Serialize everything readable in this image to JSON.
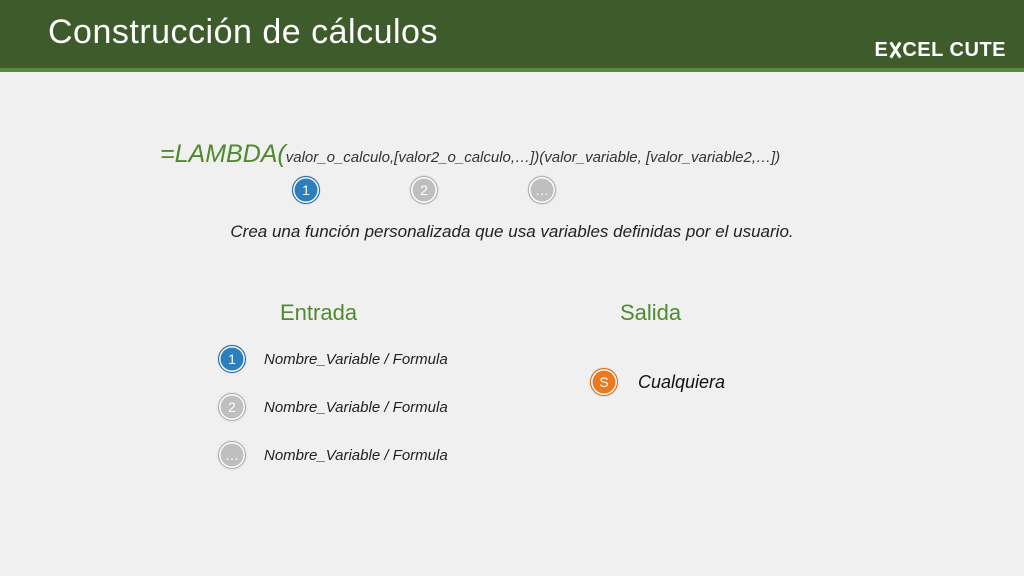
{
  "header": {
    "title": "Construcción de cálculos",
    "brand_prefix": "E",
    "brand_suffix": "CEL CUTE"
  },
  "formula": {
    "eq": "=",
    "fn": "LAMBDA",
    "paren_open": "(",
    "args": "valor_o_calculo,[valor2_o_calculo,…])",
    "call": "(valor_variable, [valor_variable2,…])"
  },
  "badges_top": [
    "1",
    "2",
    "…"
  ],
  "description": "Crea una función personalizada que usa variables definidas por el usuario.",
  "sections": {
    "input_title": "Entrada",
    "output_title": "Salida"
  },
  "inputs": [
    {
      "num": "1",
      "label": "Nombre_Variable / Formula"
    },
    {
      "num": "2",
      "label": "Nombre_Variable / Formula"
    },
    {
      "num": "…",
      "label": "Nombre_Variable / Formula"
    }
  ],
  "output": {
    "badge": "S",
    "label": "Cualquiera"
  }
}
